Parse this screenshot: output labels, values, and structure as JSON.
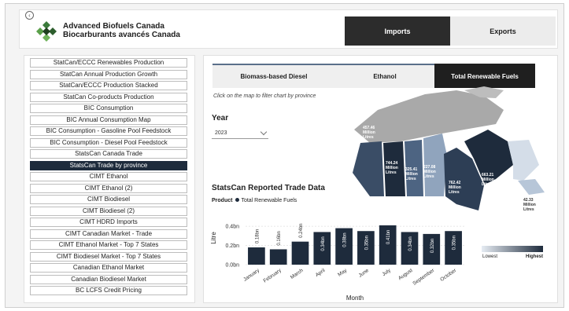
{
  "header": {
    "brand_en": "Advanced Biofuels Canada",
    "brand_fr": "Biocarburants avancés Canada",
    "tabs": [
      {
        "label": "Imports",
        "active": true
      },
      {
        "label": "Exports",
        "active": false
      }
    ]
  },
  "sidebar": {
    "items": [
      {
        "label": "StatCan/ECCC Renewables Production",
        "active": false
      },
      {
        "label": "StatCan Annual Production Growth",
        "active": false
      },
      {
        "label": "StatCan/ECCC Production Stacked",
        "active": false
      },
      {
        "label": "StatCan Co-products Production",
        "active": false
      },
      {
        "label": "BIC Consumption",
        "active": false
      },
      {
        "label": "BIC Annual Consumption Map",
        "active": false
      },
      {
        "label": "BIC Consumption - Gasoline Pool Feedstock",
        "active": false
      },
      {
        "label": "BIC Consumption - Diesel Pool Feedstock",
        "active": false
      },
      {
        "label": "StatsCan Canada Trade",
        "active": false
      },
      {
        "label": "StatsCan Trade by province",
        "active": true
      },
      {
        "label": "CIMT Ethanol",
        "active": false
      },
      {
        "label": "CIMT Ethanol (2)",
        "active": false
      },
      {
        "label": "CIMT Biodiesel",
        "active": false
      },
      {
        "label": "CIMT Biodiesel (2)",
        "active": false
      },
      {
        "label": "CIMT HDRD Imports",
        "active": false
      },
      {
        "label": "CIMT Canadian Market - Trade",
        "active": false
      },
      {
        "label": "CIMT Ethanol Market - Top 7 States",
        "active": false
      },
      {
        "label": "CIMT Biodiesel Market - Top 7 States",
        "active": false
      },
      {
        "label": "Canadian Ethanol Market",
        "active": false
      },
      {
        "label": "Canadian Biodiesel Market",
        "active": false
      },
      {
        "label": "BC LCFS Credit Pricing",
        "active": false
      }
    ]
  },
  "product_tabs": [
    {
      "label": "Biomass-based Diesel",
      "active": false
    },
    {
      "label": "Ethanol",
      "active": false
    },
    {
      "label": "Total Renewable Fuels",
      "active": true
    }
  ],
  "map": {
    "hint": "Click on the map to filter chart by province",
    "labels": [
      {
        "province": "BC",
        "lines": [
          "457.46",
          "Million",
          "Litres"
        ]
      },
      {
        "province": "AB",
        "lines": [
          "744.24",
          "Million",
          "Litres"
        ]
      },
      {
        "province": "SK",
        "lines": [
          "325.41",
          "Million",
          "Litres"
        ]
      },
      {
        "province": "MB",
        "lines": [
          "227.08",
          "Million",
          "Litres"
        ]
      },
      {
        "province": "ON",
        "lines": [
          "762.42",
          "Million",
          "Litres"
        ]
      },
      {
        "province": "QC",
        "lines": [
          "663.21",
          "Million",
          "Litres"
        ]
      },
      {
        "province": "Atlantic",
        "lines": [
          "42.33",
          "Million",
          "Litres"
        ]
      }
    ]
  },
  "year": {
    "label": "Year",
    "value": "2023"
  },
  "chart": {
    "title": "StatsCan Reported Trade Data",
    "product_label": "Product",
    "product_value": "Total Renewable Fuels"
  },
  "legend": {
    "low": "Lowest",
    "high": "Highest",
    "low_color": "#e6ecf3",
    "high_color": "#1e2b3c"
  },
  "chart_data": {
    "type": "bar",
    "categories": [
      "January",
      "February",
      "March",
      "April",
      "May",
      "June",
      "July",
      "August",
      "September",
      "October"
    ],
    "values": [
      0.18,
      0.16,
      0.24,
      0.34,
      0.38,
      0.35,
      0.41,
      0.34,
      0.32,
      0.35
    ],
    "value_labels": [
      "0.18bn",
      "0.16bn",
      "0.24bn",
      "0.34bn",
      "0.38bn",
      "0.35bn",
      "0.41bn",
      "0.34bn",
      "0.32bn",
      "0.35bn"
    ],
    "yticks": [
      "0.4bn",
      "0.2bn",
      "0.0bn"
    ],
    "ytick_values": [
      0.4,
      0.2,
      0
    ],
    "ylim": [
      0,
      0.45
    ],
    "xlabel": "Month",
    "ylabel": "Litre",
    "bar_color": "#1e2b3c",
    "grid": true
  }
}
